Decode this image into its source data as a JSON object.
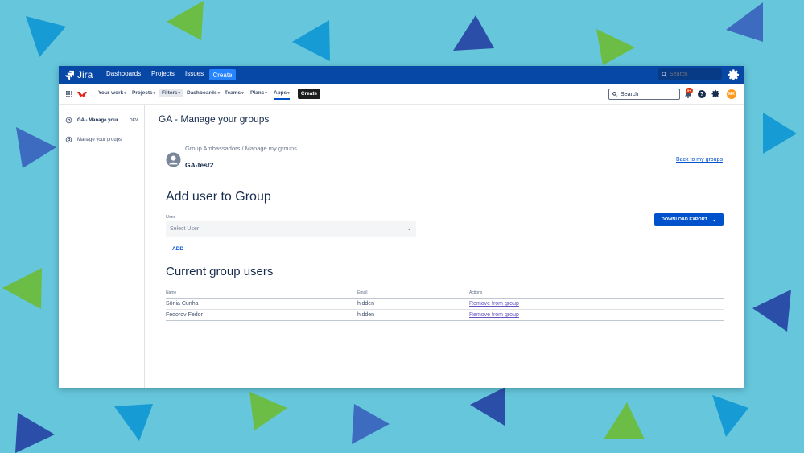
{
  "topbar": {
    "app_name": "Jira",
    "links": [
      "Dashboards",
      "Projects",
      "Issues"
    ],
    "create_label": "Create",
    "search_placeholder": "Search"
  },
  "navbar": {
    "items": [
      "Your work",
      "Projects",
      "Filters",
      "Dashboards",
      "Teams",
      "Plans",
      "Apps"
    ],
    "create_label": "Create",
    "search_placeholder": "Search",
    "notification_badge": "9+",
    "help_glyph": "?",
    "avatar_initials": "MK"
  },
  "sidebar": {
    "app_title": "GA - Manage your...",
    "dev_badge": "DEV",
    "item_label": "Manage your groups"
  },
  "main": {
    "page_title": "GA - Manage your groups",
    "breadcrumb": "Group Ambassadors  / Manage my groups",
    "group_name": "GA-test2",
    "back_link": "Back to my groups",
    "add_heading": "Add user to Group",
    "user_label": "User",
    "user_placeholder": "Select User",
    "add_button": "ADD",
    "download_button": "DOWNLOAD EXPORT",
    "current_heading": "Current group users",
    "table": {
      "headers": [
        "Name",
        "Email",
        "Actions"
      ],
      "rows": [
        {
          "name": "Sônia Cunha",
          "email": "hidden",
          "action": "Remove from group"
        },
        {
          "name": "Fedorov Fedor",
          "email": "hidden",
          "action": "Remove from group"
        }
      ]
    }
  },
  "colors": {
    "background": "#66c6dc",
    "topbar": "#0747a6",
    "primary_button": "#0052cc",
    "link": "#6554c0"
  }
}
